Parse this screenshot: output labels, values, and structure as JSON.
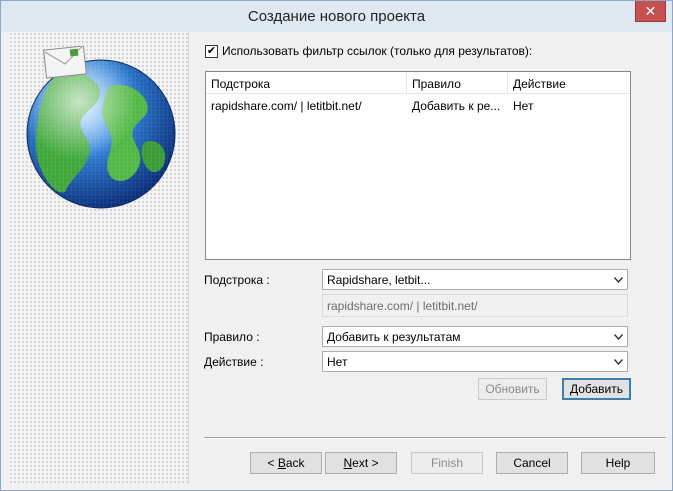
{
  "window": {
    "title": "Создание нового проекта",
    "close_glyph": "✕"
  },
  "filter": {
    "checked": true,
    "label": "Использовать фильтр ссылок (только для результатов):"
  },
  "table": {
    "columns": [
      "Подстрока",
      "Правило",
      "Действие"
    ],
    "rows": [
      [
        "rapidshare.com/ | letitbit.net/",
        "Добавить к ре...",
        "Нет"
      ]
    ]
  },
  "form": {
    "substring_label": "Подстрока :",
    "substring_value": "Rapidshare, letbit...",
    "substring_text": "rapidshare.com/ | letitbit.net/",
    "rule_label": "Правило :",
    "rule_value": "Добавить к результатам",
    "action_label": "Действие :",
    "action_value": "Нет"
  },
  "buttons": {
    "update": "Обновить",
    "add": "Добавить",
    "back_prefix": "< ",
    "back_mnemonic": "B",
    "back_rest": "ack",
    "next_mnemonic": "N",
    "next_rest": "ext >",
    "finish": "Finish",
    "cancel": "Cancel",
    "help": "Help"
  },
  "colors": {
    "accent_border": "#3c7fb1",
    "close_red": "#c75050",
    "titlebar": "#dfe7f0"
  }
}
